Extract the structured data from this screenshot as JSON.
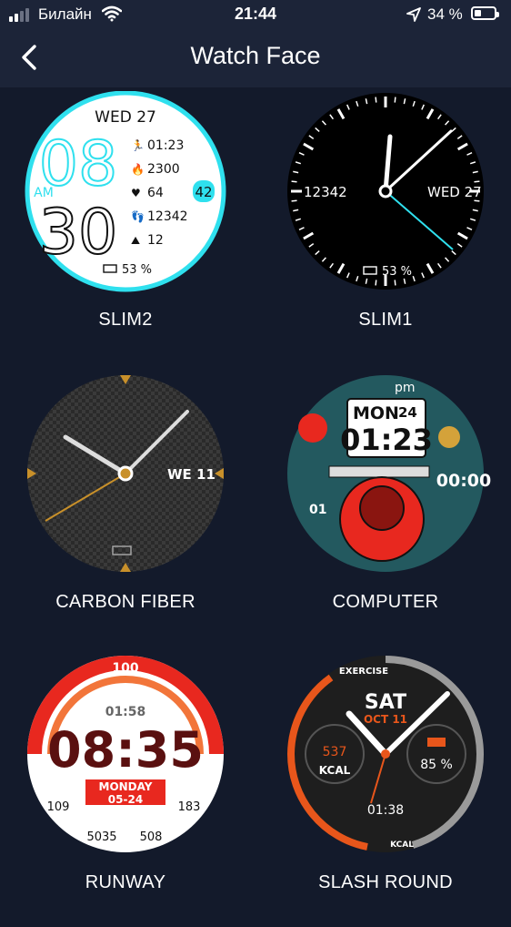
{
  "status": {
    "carrier": "Билайн",
    "time": "21:44",
    "battery_text": "34 %",
    "battery_level": 0.34
  },
  "header": {
    "title": "Watch Face"
  },
  "faces": [
    {
      "label": "SLIM2",
      "hour": "08",
      "minute": "30",
      "ampm": "AM",
      "date": "WED 27",
      "second": "42",
      "stats": [
        "01:23",
        "2300",
        "64",
        "12342",
        "12"
      ],
      "battery": "53 %"
    },
    {
      "label": "SLIM1",
      "steps": "12342",
      "date": "WED 27",
      "battery": "53 %"
    },
    {
      "label": "CARBON FIBER",
      "date": "WE 11"
    },
    {
      "label": "COMPUTER",
      "day": "MON",
      "daynum": "24",
      "time": "01:23",
      "seconds": "00:00",
      "ampm": "pm",
      "count": "01"
    },
    {
      "label": "RUNWAY",
      "top": "100",
      "small_time": "01:58",
      "time": "08:35",
      "day": "MONDAY",
      "date": "05-24",
      "left": "109",
      "right": "183",
      "bottom_left": "5035",
      "bottom_right": "508"
    },
    {
      "label": "SLASH ROUND",
      "exercise": "EXERCISE",
      "day": "SAT",
      "date": "OCT 11",
      "kcal": "537",
      "kcal_label": "KCAL",
      "battery": "85 %",
      "time": "01:38",
      "arc_label": "KCAL"
    }
  ],
  "colors": {
    "background": "#131a2b",
    "bar": "#1c2438",
    "cyan": "#2fe0ee",
    "orange": "#e8561b",
    "red": "#e8281f",
    "gold": "#c8902a"
  },
  "icons": [
    "signal-icon",
    "wifi-icon",
    "location-arrow-icon",
    "battery-icon",
    "back-chevron-icon"
  ]
}
